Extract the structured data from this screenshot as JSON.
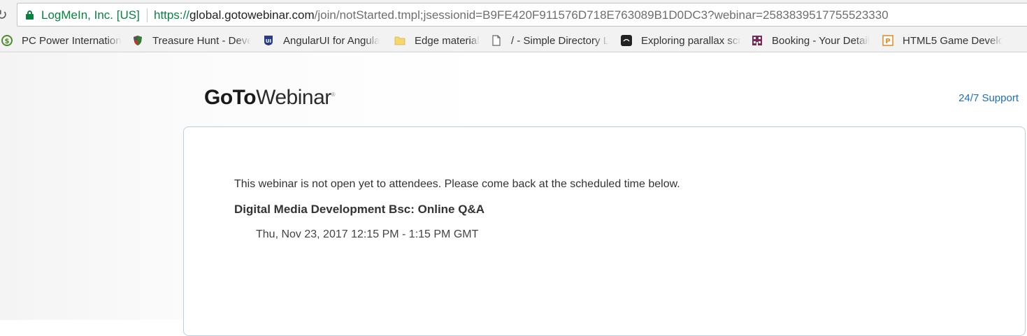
{
  "browser": {
    "site_identity": "LogMeIn, Inc. [US]",
    "url_scheme": "https://",
    "url_host": "global.gotowebinar.com",
    "url_path": "/join/notStarted.tmpl;jsessionid=B9FE420F911576D718E763089B1D0DC3?webinar=2583839517755523330"
  },
  "bookmarks": [
    {
      "label": "PC Power Internation",
      "icon": "dollar-circle-icon",
      "color": "#4e8a2f"
    },
    {
      "label": "Treasure Hunt - Deve",
      "icon": "shield-icon",
      "color": "#c0392b"
    },
    {
      "label": "AngularUI for Angula",
      "icon": "angularui-logo-icon",
      "color": "#2a3a8c"
    },
    {
      "label": "Edge material",
      "icon": "folder-icon",
      "color": "#f5d76e"
    },
    {
      "label": "/ - Simple Directory L",
      "icon": "page-icon",
      "color": "#666666"
    },
    {
      "label": "Exploring parallax scr",
      "icon": "codrops-icon",
      "color": "#222222"
    },
    {
      "label": "Booking - Your Detail",
      "icon": "building-icon",
      "color": "#7a2a5a"
    },
    {
      "label": "HTML5 Game Develo",
      "icon": "phaser-icon",
      "color": "#e08a1e"
    }
  ],
  "header": {
    "logo_bold": "GoTo",
    "logo_light": "Webinar",
    "logo_mark": "®",
    "support_link": "24/7 Support"
  },
  "notice": {
    "message": "This webinar is not open yet to attendees. Please come back at the scheduled time below.",
    "webinar_title": "Digital Media Development Bsc: Online Q&A",
    "schedule": "Thu, Nov 23, 2017 12:15 PM - 1:15 PM GMT"
  },
  "colors": {
    "secure_green": "#0b8043",
    "link_blue": "#1f6fb5",
    "card_border": "#b9cfe0"
  }
}
